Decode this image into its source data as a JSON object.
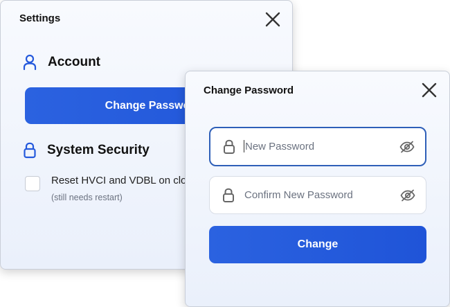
{
  "settings": {
    "title": "Settings",
    "account": {
      "heading": "Account",
      "change_password_label": "Change Password"
    },
    "security": {
      "heading": "System Security",
      "reset_label": "Reset HVCI and VDBL on close",
      "reset_sub": "(still needs restart)",
      "reset_checked": false
    }
  },
  "change_password_dialog": {
    "title": "Change Password",
    "new_password_placeholder": "New Password",
    "confirm_password_placeholder": "Confirm New Password",
    "submit_label": "Change"
  },
  "icons": {
    "close": "close-icon",
    "user": "user-icon",
    "lock": "lock-icon",
    "eye_off": "eye-off-icon"
  },
  "colors": {
    "accent": "#2459dc",
    "focus_border": "#2e5fb8",
    "panel_bg": "#eef3fc"
  }
}
